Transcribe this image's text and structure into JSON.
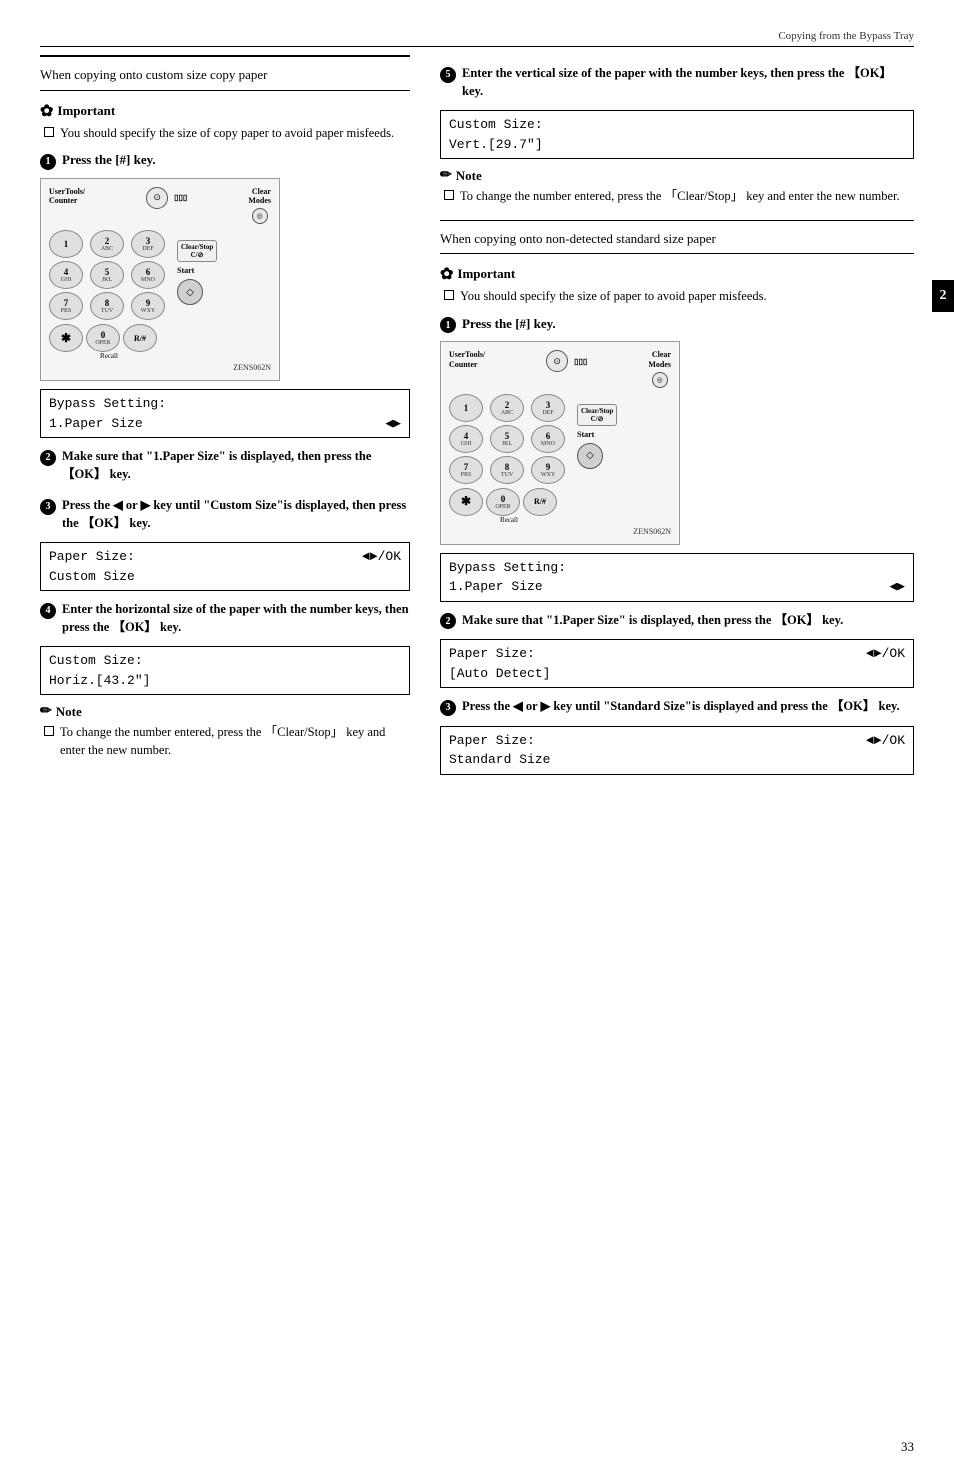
{
  "header": {
    "title": "Copying from the Bypass Tray"
  },
  "page_num": "33",
  "page_tab": "2",
  "left_col": {
    "section_title": "When copying onto custom size copy paper",
    "important_label": "Important",
    "important_bullets": [
      "You should specify the size of copy paper to avoid paper misfeeds."
    ],
    "step1": {
      "label": "Press the",
      "key": "[#]",
      "suffix": "key."
    },
    "panel1_zen": "ZENS062N",
    "bypass_display_line1": "Bypass Setting:",
    "bypass_display_line2": "1.Paper Size",
    "step2": {
      "text": "Make sure that “1.Paper Size” is displayed, then press the",
      "key": "「OK」",
      "suffix": "key."
    },
    "step3": {
      "text": "Press the",
      "left_key": "◄",
      "or": "or",
      "right_key": "►",
      "suffix": "key until “Custom Size”is displayed, then press the",
      "ok_key": "「OK」",
      "end": "key."
    },
    "paper_size_display_line1_left": "Paper Size:",
    "paper_size_display_line1_right": "◄►/OK",
    "paper_size_display_line2": "Custom Size",
    "step4": {
      "text": "Enter the horizontal size of the paper with the number keys, then press the",
      "key": "「OK」",
      "suffix": "key."
    },
    "custom_horiz_line1": "Custom Size:",
    "custom_horiz_line2": "Horiz.[43.2\"]",
    "note_label": "Note",
    "note_bullets": [
      "To change the number entered, press the 「Clear/Stop」 key and enter the new number."
    ]
  },
  "right_col": {
    "step5": {
      "text": "Enter the vertical size of the paper with the number keys, then press the",
      "key": "「OK」",
      "suffix": "key."
    },
    "custom_vert_line1": "Custom Size:",
    "custom_vert_line2": "Vert.[29.7\"]",
    "note_label": "Note",
    "note_bullets": [
      "To change the number entered, press the 「Clear/Stop」 key and enter the new number."
    ],
    "section2_title": "When copying onto non-detected standard size paper",
    "important_label": "Important",
    "important_bullets": [
      "You should specify the size of paper to avoid paper misfeeds."
    ],
    "step1": {
      "label": "Press the",
      "key": "[#]",
      "suffix": "key."
    },
    "panel2_zen": "ZENS062N",
    "bypass_display_line1": "Bypass Setting:",
    "bypass_display_line2": "1.Paper Size",
    "step2": {
      "text": "Make sure that “1.Paper Size” is displayed, then press the",
      "key": "「OK」",
      "suffix": "key."
    },
    "paper_size_auto_line1_left": "Paper Size:",
    "paper_size_auto_line1_right": "◄►/OK",
    "paper_size_auto_line2": "[Auto Detect]",
    "step3": {
      "text": "Press the",
      "left_key": "◄",
      "or": "or",
      "right_key": "►",
      "suffix": "key until “Standard Size”is displayed and press the",
      "ok_key": "「OK」",
      "end": "key."
    },
    "paper_size_std_line1_left": "Paper Size:",
    "paper_size_std_line1_right": "◄►/OK",
    "paper_size_std_line2": "Standard Size"
  },
  "numpad": {
    "keys": [
      {
        "main": "1",
        "sub": ""
      },
      {
        "main": "2",
        "sub": "ABC"
      },
      {
        "main": "3",
        "sub": "DEF"
      },
      {
        "main": "4",
        "sub": "GHI"
      },
      {
        "main": "5",
        "sub": "JKL"
      },
      {
        "main": "6",
        "sub": "MNO"
      },
      {
        "main": "7",
        "sub": "PRS"
      },
      {
        "main": "8",
        "sub": "TUV"
      },
      {
        "main": "9",
        "sub": "WXY"
      }
    ],
    "bottom_keys": [
      {
        "main": "✱",
        "sub": ""
      },
      {
        "main": "0",
        "sub": "OPER"
      },
      {
        "main": "R/#",
        "sub": ""
      }
    ],
    "clear_stop": "Clear/Stop\nC/⊘",
    "start": "Start",
    "recall": "Recall"
  }
}
